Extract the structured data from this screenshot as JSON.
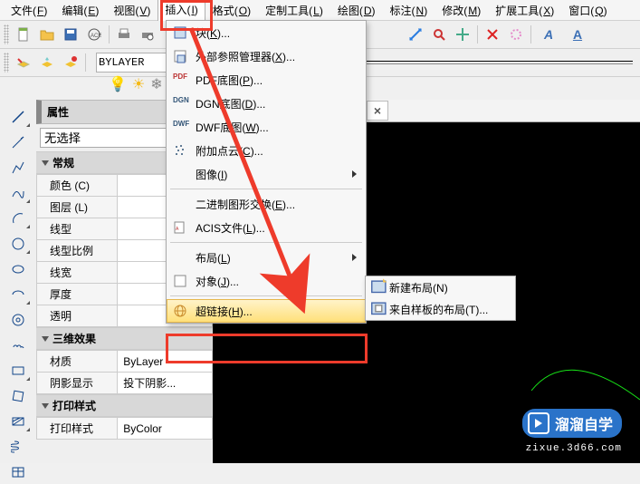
{
  "menubar": [
    {
      "label": "文件",
      "key": "F"
    },
    {
      "label": "编辑",
      "key": "E"
    },
    {
      "label": "视图",
      "key": "V"
    },
    {
      "label": "插入",
      "key": "I",
      "active": true
    },
    {
      "label": "格式",
      "key": "O"
    },
    {
      "label": "定制工具",
      "key": "L"
    },
    {
      "label": "绘图",
      "key": "D"
    },
    {
      "label": "标注",
      "key": "N"
    },
    {
      "label": "修改",
      "key": "M"
    },
    {
      "label": "扩展工具",
      "key": "X"
    },
    {
      "label": "窗口",
      "key": "Q"
    }
  ],
  "insert_menu": {
    "items": [
      {
        "label": "块",
        "key": "K",
        "icon": "block"
      },
      {
        "label": "外部参照管理器",
        "key": "X",
        "icon": "xref"
      },
      {
        "label": "PDF底图",
        "key": "P",
        "icon": "pdf"
      },
      {
        "label": "DGN底图",
        "key": "D",
        "icon": "dgn"
      },
      {
        "label": "DWF底图",
        "key": "W",
        "icon": "dwf"
      },
      {
        "label": "附加点云",
        "key": "C",
        "icon": "cloud"
      },
      {
        "label": "图像",
        "key": "I",
        "submenu": true
      },
      {
        "sep": true
      },
      {
        "label": "二进制图形交换",
        "key": "E"
      },
      {
        "label": "ACIS文件",
        "key": "L",
        "icon": "acis"
      },
      {
        "sep": true
      },
      {
        "label": "布局",
        "key": "L",
        "submenu": true
      },
      {
        "label": "对象",
        "key": "J",
        "icon": "obj"
      },
      {
        "sep": true
      },
      {
        "label": "超链接",
        "key": "H",
        "icon": "globe",
        "hover": true
      }
    ]
  },
  "layout_submenu": [
    {
      "label": "新建布局",
      "key": "N"
    },
    {
      "label": "来自样板的布局",
      "key": "T"
    }
  ],
  "layer_select_value": "BYLAYER",
  "tab_close": "×",
  "properties": {
    "title": "属性",
    "select_none": "无选择",
    "groups": [
      {
        "name": "常规",
        "rows": [
          {
            "k": "颜色 (C)",
            "v": ""
          },
          {
            "k": "图层 (L)",
            "v": ""
          },
          {
            "k": "线型",
            "v": ""
          },
          {
            "k": "线型比例",
            "v": ""
          },
          {
            "k": "线宽",
            "v": ""
          },
          {
            "k": "厚度",
            "v": ""
          },
          {
            "k": "透明",
            "v": ""
          }
        ]
      },
      {
        "name": "三维效果",
        "rows": [
          {
            "k": "材质",
            "v": "ByLayer"
          },
          {
            "k": "阴影显示",
            "v": "投下阴影..."
          }
        ]
      },
      {
        "name": "打印样式",
        "rows": [
          {
            "k": "打印样式",
            "v": "ByColor"
          }
        ]
      }
    ],
    "toggler": "I←"
  },
  "watermark": {
    "brand": "溜溜自学",
    "url": "zixue.3d66.com"
  }
}
